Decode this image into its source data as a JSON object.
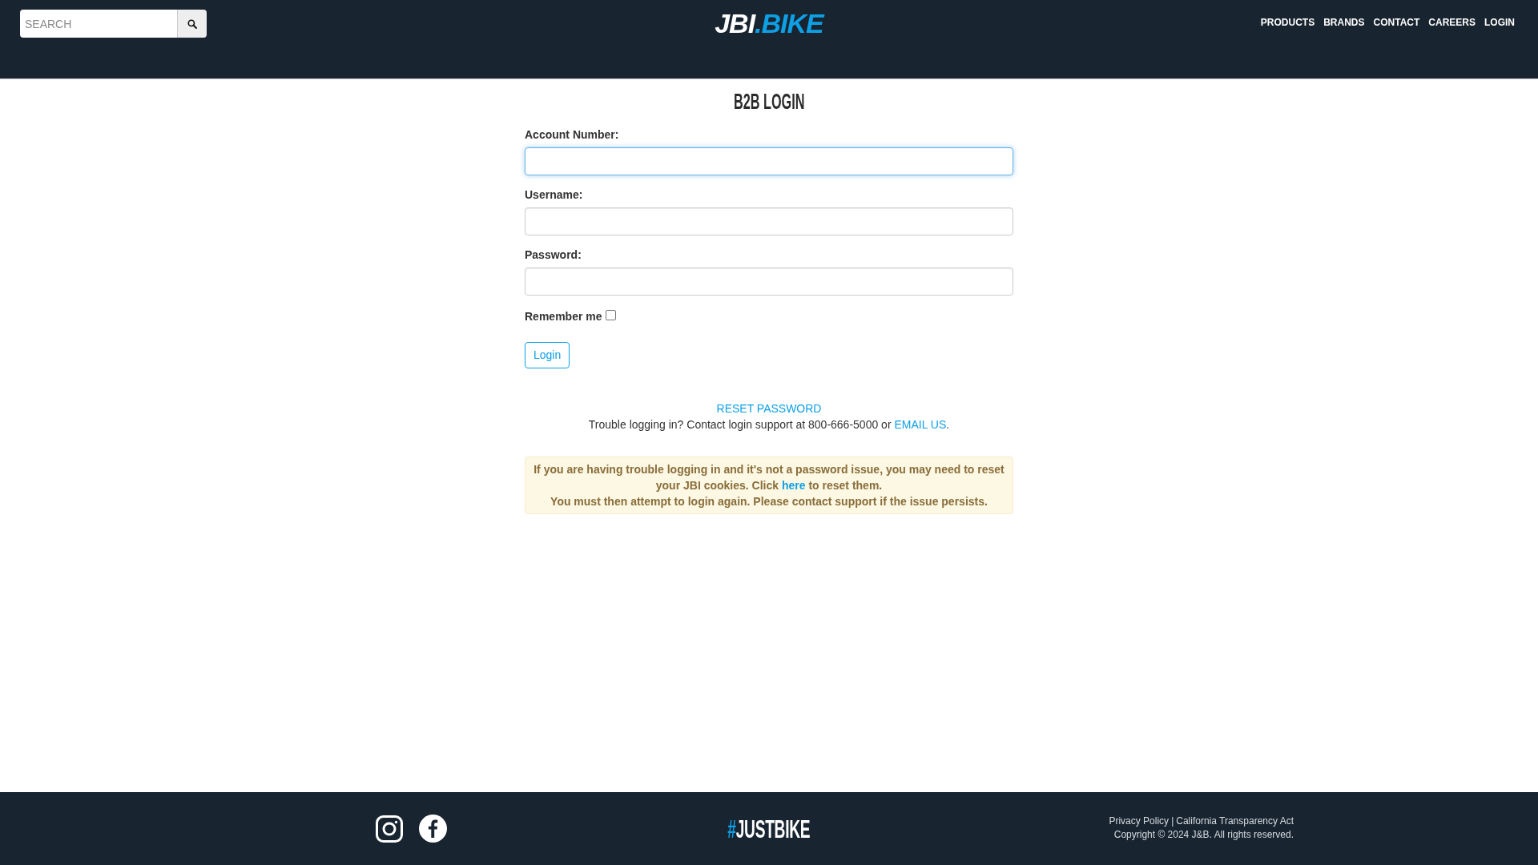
{
  "header": {
    "search": {
      "placeholder": "SEARCH"
    },
    "logo": {
      "prefix": "JBI",
      "suffix": ".BIKE"
    },
    "nav": [
      "PRODUCTS",
      "BRANDS",
      "CONTACT",
      "CAREERS",
      "LOGIN"
    ]
  },
  "login": {
    "title": "B2B LOGIN",
    "fields": [
      {
        "label": "Account Number:",
        "focused": true
      },
      {
        "label": "Username:",
        "focused": false
      },
      {
        "label": "Password:",
        "focused": false
      }
    ],
    "remember": {
      "label": "Remember me",
      "checked": false
    },
    "submit": "Login",
    "reset_link": "RESET PASSWORD",
    "support": {
      "text_before": "Trouble logging in? Contact login support at 800-666-5000 or",
      "link": "EMAIL US",
      "text_after": "."
    },
    "notice": {
      "text_before": "If you are having trouble logging in and it's not a password issue, you may need to reset your JBI cookies. Click",
      "link": "here",
      "text_after": "to reset them.",
      "second_line": "You must then attempt to login again. Please contact support if the issue persists."
    }
  },
  "footer": {
    "tagline": {
      "prefix": "#",
      "text": "JUSTBIKE"
    },
    "links": [
      "Privacy Policy",
      "California Transparency Act"
    ],
    "separator": "|",
    "copyright": "Copyright © 2024 J&B. All rights reserved."
  }
}
